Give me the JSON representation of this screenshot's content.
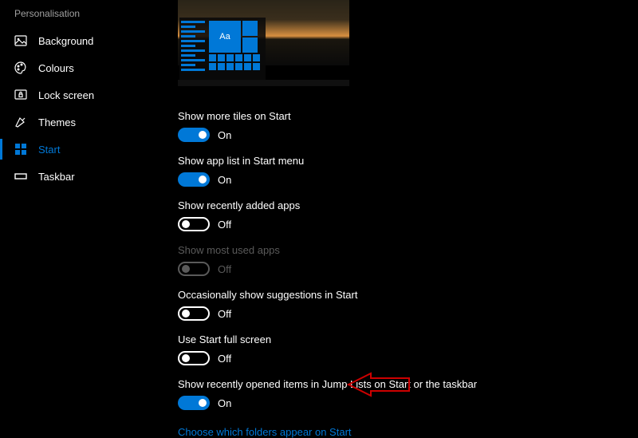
{
  "sidebar": {
    "title": "Personalisation",
    "items": [
      {
        "label": "Background"
      },
      {
        "label": "Colours"
      },
      {
        "label": "Lock screen"
      },
      {
        "label": "Themes"
      },
      {
        "label": "Start"
      },
      {
        "label": "Taskbar"
      }
    ]
  },
  "preview": {
    "tile_text": "Aa"
  },
  "settings": [
    {
      "label": "Show more tiles on Start",
      "on": true,
      "state": "On",
      "disabled": false
    },
    {
      "label": "Show app list in Start menu",
      "on": true,
      "state": "On",
      "disabled": false
    },
    {
      "label": "Show recently added apps",
      "on": false,
      "state": "Off",
      "disabled": false
    },
    {
      "label": "Show most used apps",
      "on": false,
      "state": "Off",
      "disabled": true
    },
    {
      "label": "Occasionally show suggestions in Start",
      "on": false,
      "state": "Off",
      "disabled": false
    },
    {
      "label": "Use Start full screen",
      "on": false,
      "state": "Off",
      "disabled": false
    },
    {
      "label": "Show recently opened items in Jump Lists on Start or the taskbar",
      "on": true,
      "state": "On",
      "disabled": false
    }
  ],
  "link": {
    "label": "Choose which folders appear on Start"
  },
  "colors": {
    "accent": "#0078d7"
  }
}
